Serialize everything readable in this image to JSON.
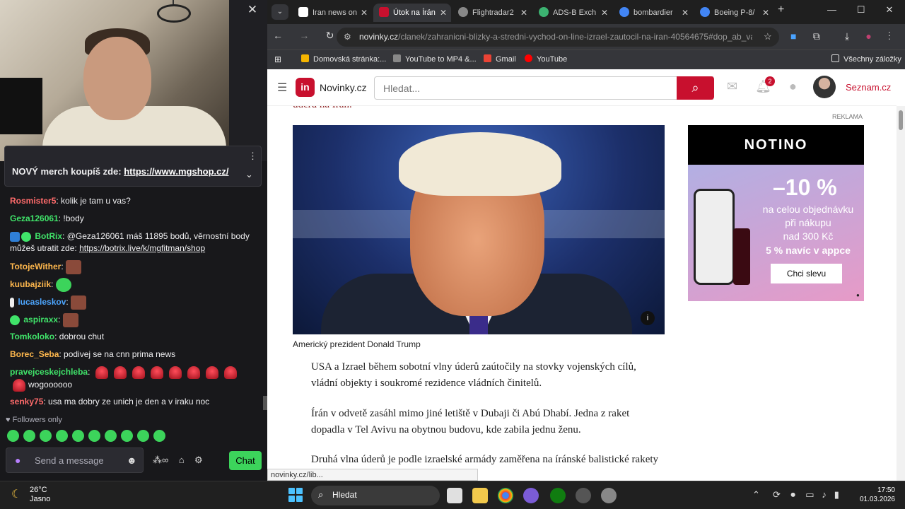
{
  "stream": {
    "close_label": "✕",
    "pinned": {
      "text": "NOVÝ merch koupíš zde:",
      "link": "https://www.mgshop.cz/"
    },
    "chat": [
      {
        "user": "Rosmister5",
        "color": "#ff6b6b",
        "text": "kolik je tam u vas?"
      },
      {
        "user": "Geza126061",
        "color": "#40e46a",
        "text": "!body"
      },
      {
        "user": "BotRix",
        "color": "#40e46a",
        "text": "@Geza126061 máš 11895 bodů, věrnostní body můžeš utratit zde:",
        "link": "https://botrix.live/k/mgfitman/shop"
      },
      {
        "user": "TotojeWither",
        "color": "#ffb84d",
        "text": ""
      },
      {
        "user": "kuubajziik",
        "color": "#ffb84d",
        "text": ""
      },
      {
        "user": "lucasleskov",
        "color": "#4da6ff",
        "text": ""
      },
      {
        "user": "aspiraxx",
        "color": "#40e46a",
        "text": ""
      },
      {
        "user": "Tomkoloko",
        "color": "#40e46a",
        "text": "dobrou chut"
      },
      {
        "user": "Borec_Seba",
        "color": "#ffb84d",
        "text": "podivej se na cnn prima news"
      },
      {
        "user": "pravejceskejchleba",
        "color": "#40e46a",
        "text": "wogoooooo"
      },
      {
        "user": "senky75",
        "color": "#ff6b6b",
        "text": "usa ma dobry ze unich je den a v iraku noc"
      }
    ],
    "followers_only": "Followers only",
    "message_placeholder": "Send a message",
    "chat_button": "Chat"
  },
  "browser": {
    "tabs": [
      {
        "title": "Iran news on",
        "color": "#ffffff"
      },
      {
        "title": "Útok na Írán",
        "color": "#c8102e"
      },
      {
        "title": "Flightradar2",
        "color": "#888888"
      },
      {
        "title": "ADS-B Exch",
        "color": "#3cb371"
      },
      {
        "title": "bombardier",
        "color": "#4285f4"
      },
      {
        "title": "Boeing P-8/",
        "color": "#4285f4"
      }
    ],
    "url_domain": "novinky.cz",
    "url_path": "/clanek/zahranicni-blizky-a-stredni-vychod-on-line-izrael-zautocil-na-iran-40564675#dop_ab_va...",
    "bookmarks": [
      "Domovská stránka:...",
      "YouTube to MP4 &...",
      "Gmail",
      "YouTube"
    ],
    "bookmarks_all": "Všechny záložky",
    "status_url": "novinky.cz/lib..."
  },
  "site": {
    "logo_letter": "in",
    "logo_text": "Novinky.cz",
    "search_placeholder": "Hledat...",
    "notif_count": "2",
    "seznam": "Seznam.cz",
    "ghost_text": "úderů na Írán.",
    "reklama": "REKLAMA",
    "photo_caption": "Americký prezident Donald Trump",
    "paragraphs": [
      "USA a Izrael během sobotní vlny úderů zaútočily na stovky vojenských cílů, vládní objekty i soukromé rezidence vládních činitelů.",
      "Írán v odvetě zasáhl mimo jiné letiště v Dubaji či Abú Dhabí. Jedna z raket dopadla v Tel Avivu na obytnou budovu, kde zabila jednu ženu.",
      "Druhá vlna úderů je podle izraelské armády zaměřena na íránské balistické rakety a systémy protivzdušné obrany."
    ],
    "ad": {
      "brand": "NOTINO",
      "discount": "–10 %",
      "line1": "na celou objednávku",
      "line2": "při nákupu",
      "line3": "nad 300 Kč",
      "line4": "5 % navíc v appce",
      "button": "Chci slevu"
    }
  },
  "taskbar": {
    "temp": "26°C",
    "weather": "Jasno",
    "search": "Hledat",
    "time": "17:50",
    "date": "01.03.2026"
  }
}
